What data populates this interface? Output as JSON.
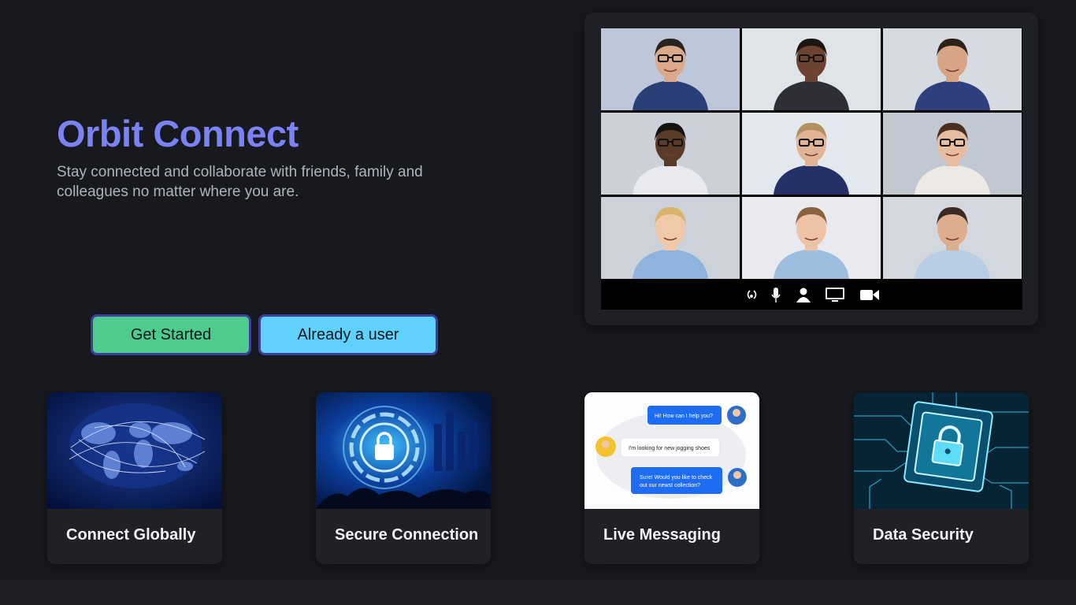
{
  "hero": {
    "title": "Orbit Connect",
    "subtitle": "Stay connected and collaborate with friends, family and colleagues no matter where you are."
  },
  "buttons": {
    "primary_label": "Get Started",
    "secondary_label": "Already a user"
  },
  "colors": {
    "accent_title": "#7b82f4",
    "primary_button": "#4ecb8d",
    "secondary_button": "#5fd1fb",
    "background": "#18191e"
  },
  "video_call": {
    "participants": 9,
    "controls": [
      "speaker-icon",
      "microphone-icon",
      "participants-icon",
      "screen-share-icon",
      "camera-icon"
    ]
  },
  "features": [
    {
      "title": "Connect Globally",
      "icon": "world-map-image"
    },
    {
      "title": "Secure Connection",
      "icon": "padlock-image"
    },
    {
      "title": "Live Messaging",
      "icon": "chat-image",
      "chat": {
        "message_1": "Hi! How can I help you?",
        "message_2": "I'm looking for new jogging shoes",
        "message_3_line1": "Sure! Would you like to check",
        "message_3_line2": "out our newst collection?"
      }
    },
    {
      "title": "Data Security",
      "icon": "chip-lock-image"
    }
  ]
}
